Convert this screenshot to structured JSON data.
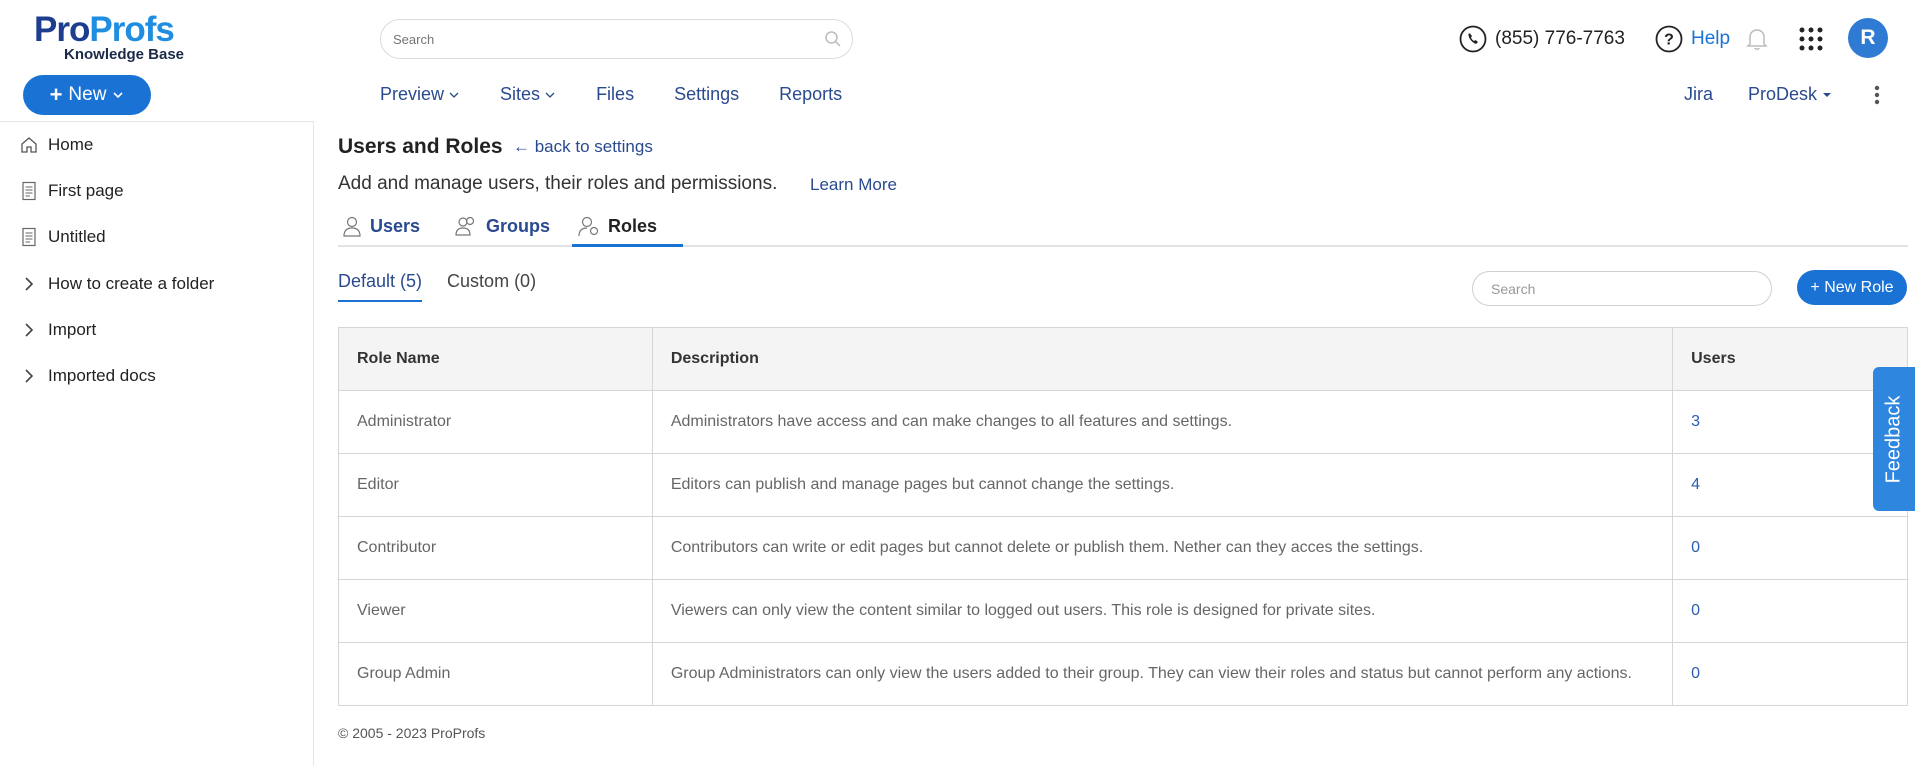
{
  "brand": {
    "logo_pro1": "Pro",
    "logo_pro2": "Profs",
    "logo_sub": "Knowledge Base",
    "accent": "#1a73d4"
  },
  "header": {
    "new_label": "New",
    "search_placeholder": "Search",
    "nav": [
      "Preview",
      "Sites",
      "Files",
      "Settings",
      "Reports"
    ],
    "phone": "(855) 776-7763",
    "help": "Help",
    "avatar_initial": "R",
    "right_nav": [
      "Jira",
      "ProDesk"
    ]
  },
  "sidebar": {
    "items": [
      {
        "label": "Home",
        "icon": "home-icon"
      },
      {
        "label": "First page",
        "icon": "page-icon"
      },
      {
        "label": "Untitled",
        "icon": "page-icon"
      },
      {
        "label": "How to create a folder",
        "icon": "chevron-right-icon"
      },
      {
        "label": "Import",
        "icon": "chevron-right-icon"
      },
      {
        "label": "Imported docs",
        "icon": "chevron-right-icon"
      }
    ]
  },
  "main": {
    "title": "Users and Roles",
    "back_link": "← back to settings",
    "subtitle": "Add and manage users, their roles and permissions.",
    "learn_more": "Learn More",
    "tabs": [
      "Users",
      "Groups",
      "Roles"
    ],
    "subtabs": [
      "Default (5)",
      "Custom (0)"
    ],
    "search_placeholder": "Search",
    "new_role": "+ New Role",
    "table": {
      "headers": [
        "Role Name",
        "Description",
        "Users"
      ],
      "rows": [
        [
          "Administrator",
          "Administrators have access and can make changes to all features and settings.",
          "3"
        ],
        [
          "Editor",
          "Editors can publish and manage pages but cannot change the settings.",
          "4"
        ],
        [
          "Contributor",
          "Contributors can write or edit pages but cannot delete or publish them. Nether can they acces the settings.",
          "0"
        ],
        [
          "Viewer",
          "Viewers can only view the content similar to logged out users. This role is designed for private sites.",
          "0"
        ],
        [
          "Group Admin",
          "Group Administrators can only view the users added to their group. They can view their roles and status but cannot perform any actions.",
          "0"
        ]
      ]
    },
    "footer": "© 2005 - 2023 ProProfs"
  },
  "feedback": "Feedback"
}
